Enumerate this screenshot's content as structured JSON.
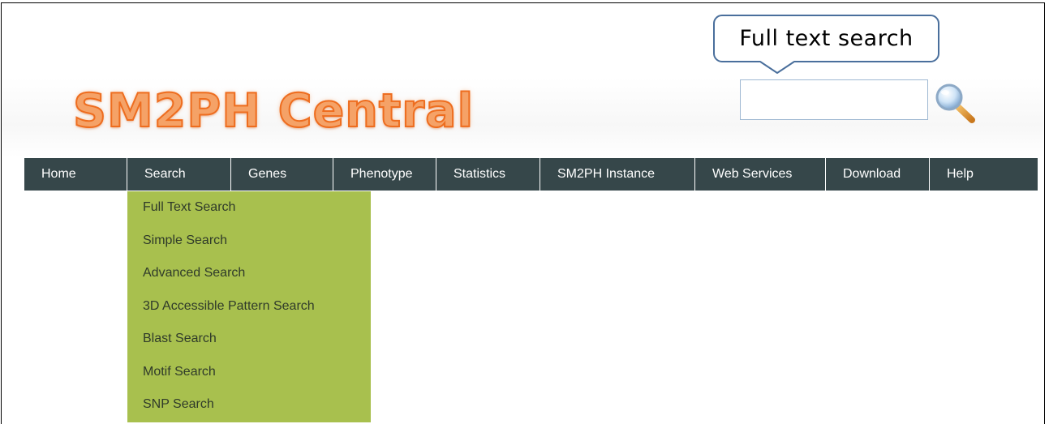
{
  "callout": {
    "text": "Full text search"
  },
  "search": {
    "placeholder": "",
    "value": ""
  },
  "logo": {
    "text": "SM2PH Central"
  },
  "nav": {
    "items": [
      {
        "label": "Home"
      },
      {
        "label": "Search"
      },
      {
        "label": "Genes"
      },
      {
        "label": "Phenotype"
      },
      {
        "label": "Statistics"
      },
      {
        "label": "SM2PH Instance"
      },
      {
        "label": "Web Services"
      },
      {
        "label": "Download"
      },
      {
        "label": "Help"
      }
    ],
    "active": "Search"
  },
  "dropdown": {
    "items": [
      {
        "label": "Full Text Search"
      },
      {
        "label": "Simple Search"
      },
      {
        "label": "Advanced Search"
      },
      {
        "label": "3D Accessible Pattern Search"
      },
      {
        "label": "Blast Search"
      },
      {
        "label": "Motif Search"
      },
      {
        "label": "SNP Search"
      }
    ]
  },
  "colors": {
    "nav_bg": "#36474a",
    "dropdown_bg": "#a8c04e",
    "logo_fill": "#f5a267",
    "logo_stroke": "#ee6d1f",
    "callout_border": "#4a6f9c"
  },
  "icons": {
    "search_button": "magnifier-icon"
  }
}
